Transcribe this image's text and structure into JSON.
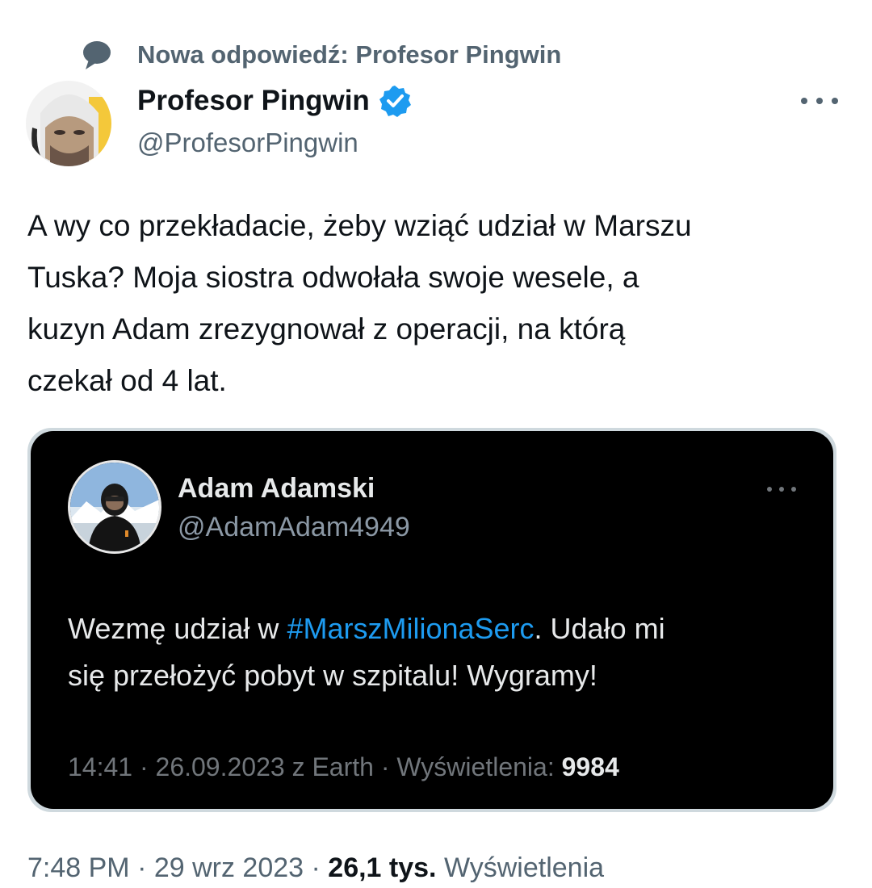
{
  "context": {
    "icon": "speech-bubble-icon",
    "text": "Nowa odpowiedź: Profesor Pingwin"
  },
  "tweet": {
    "author_name": "Profesor Pingwin",
    "author_handle": "@ProfesorPingwin",
    "verified_icon": "verified-badge-icon",
    "more_icon": "more-options-icon",
    "lines": [
      "A wy co przekładacie, żeby wziąć udział w Marszu",
      "Tuska? Moja siostra odwołała swoje wesele, a",
      "kuzyn Adam zrezygnował z operacji, na którą",
      "czekał od 4 lat."
    ],
    "time": "7:48 PM",
    "sep1": " · ",
    "date": "29 wrz 2023",
    "sep2": " · ",
    "views_count": "26,1 tys.",
    "views_label": " Wyświetlenia"
  },
  "quoted": {
    "author_name": "Adam Adamski",
    "author_handle": "@AdamAdam4949",
    "more_icon": "more-options-icon",
    "text_before": "Wezmę udział w ",
    "hashtag": "#MarszMilionaSerc",
    "text_after_line1": ". Udało mi",
    "text_line2": "się przełożyć pobyt w szpitalu! Wygramy!",
    "meta": "14:41 · 26.09.2023 z Earth · Wyświetlenia: ",
    "views": "9984"
  },
  "colors": {
    "primary_text": "#0f1419",
    "secondary_text": "#536471",
    "dark_card_bg": "#000000",
    "dark_text": "#e7e9ea",
    "dark_secondary": "#71767b",
    "link_blue": "#1d9bf0",
    "verified_blue": "#1d9bf0"
  }
}
